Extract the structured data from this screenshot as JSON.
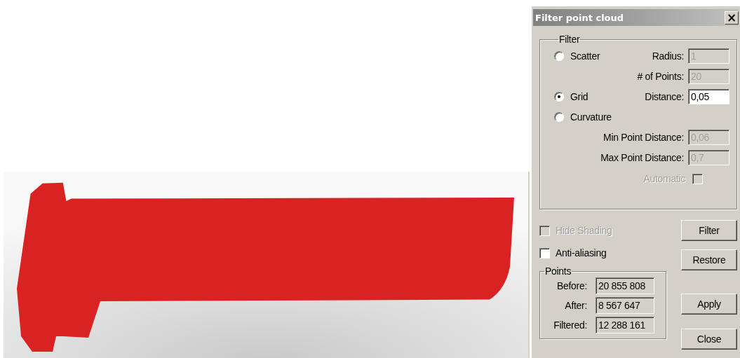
{
  "dialog": {
    "title": "Filter point cloud",
    "close_glyph": "×",
    "filter_group": {
      "label": "Filter",
      "rows": [
        {
          "kind": "radio",
          "label": "Scatter",
          "selected": false,
          "field": {
            "label": "Radius:",
            "value": "1",
            "disabled": true
          }
        },
        {
          "kind": "field",
          "field": {
            "label": "# of Points:",
            "value": "20",
            "disabled": true
          }
        },
        {
          "kind": "radio",
          "label": "Grid",
          "selected": true,
          "field": {
            "label": "Distance:",
            "value": "0,05",
            "disabled": false
          }
        },
        {
          "kind": "radio",
          "label": "Curvature",
          "selected": false
        },
        {
          "kind": "field",
          "field": {
            "label": "Min Point Distance:",
            "value": "0,06",
            "disabled": true
          }
        },
        {
          "kind": "field",
          "field": {
            "label": "Max Point Distance:",
            "value": "0,7",
            "disabled": true
          }
        },
        {
          "kind": "checkbox",
          "label": "Automatic",
          "checked": false,
          "disabled": true
        }
      ]
    },
    "options": [
      {
        "label": "Hide Shading",
        "checked": false,
        "disabled": true
      },
      {
        "label": "Anti-aliasing",
        "checked": false,
        "disabled": false
      }
    ],
    "points_group": {
      "label": "Points",
      "rows": [
        {
          "label": "Before:",
          "value": "20 855 808"
        },
        {
          "label": "After:",
          "value": "8 567 647"
        },
        {
          "label": "Filtered:",
          "value": "12 288 161"
        }
      ]
    },
    "buttons": [
      "Filter",
      "Restore",
      "Apply",
      "Close"
    ]
  }
}
